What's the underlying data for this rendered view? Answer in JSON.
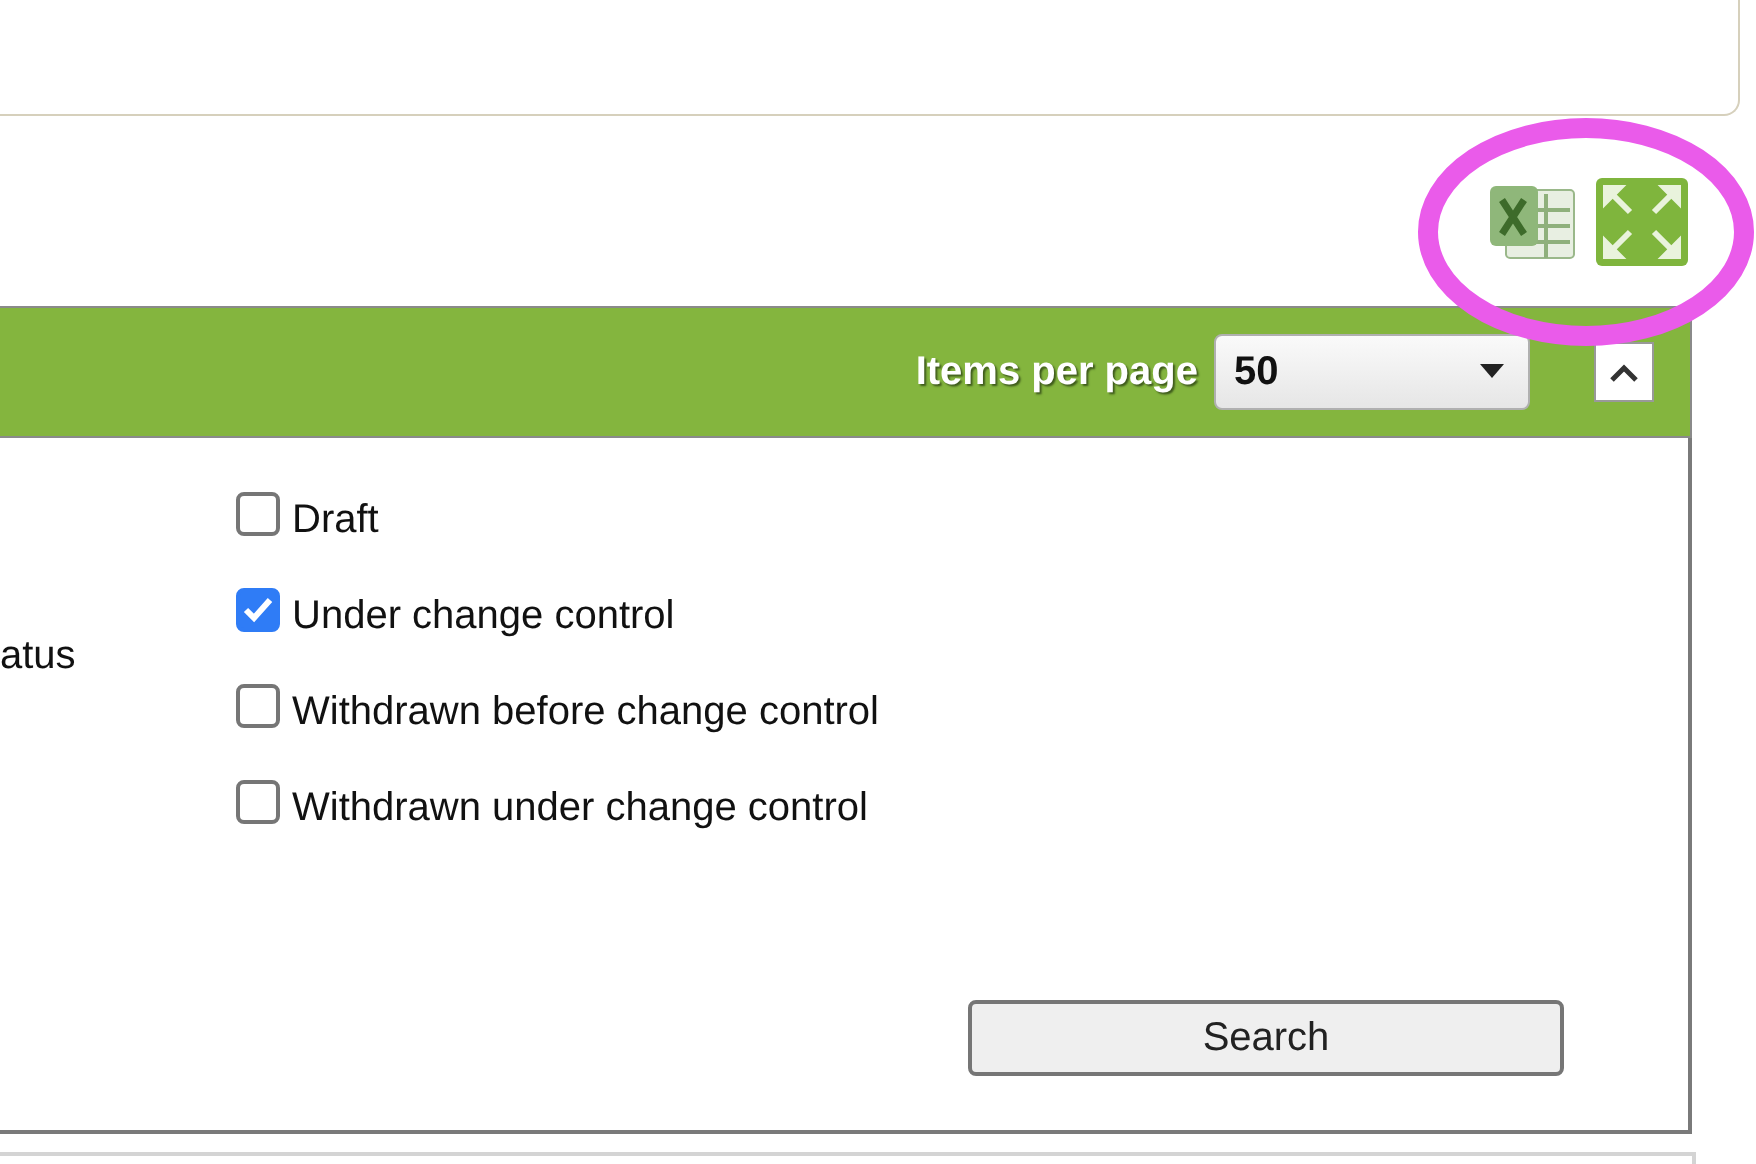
{
  "toolbar": {
    "icons": [
      {
        "kind": "spreadsheet"
      },
      {
        "kind": "expand"
      }
    ],
    "annotation": {
      "kind": "ellipse"
    }
  },
  "header": {
    "items_label": "Items per page",
    "items_value": "50"
  },
  "filter": {
    "label": "atus",
    "options": [
      {
        "label": "Draft",
        "checked": false
      },
      {
        "label": "Under change control",
        "checked": true
      },
      {
        "label": "Withdrawn before change control",
        "checked": false
      },
      {
        "label": "Withdrawn under change control",
        "checked": false
      }
    ],
    "button": "Search"
  }
}
